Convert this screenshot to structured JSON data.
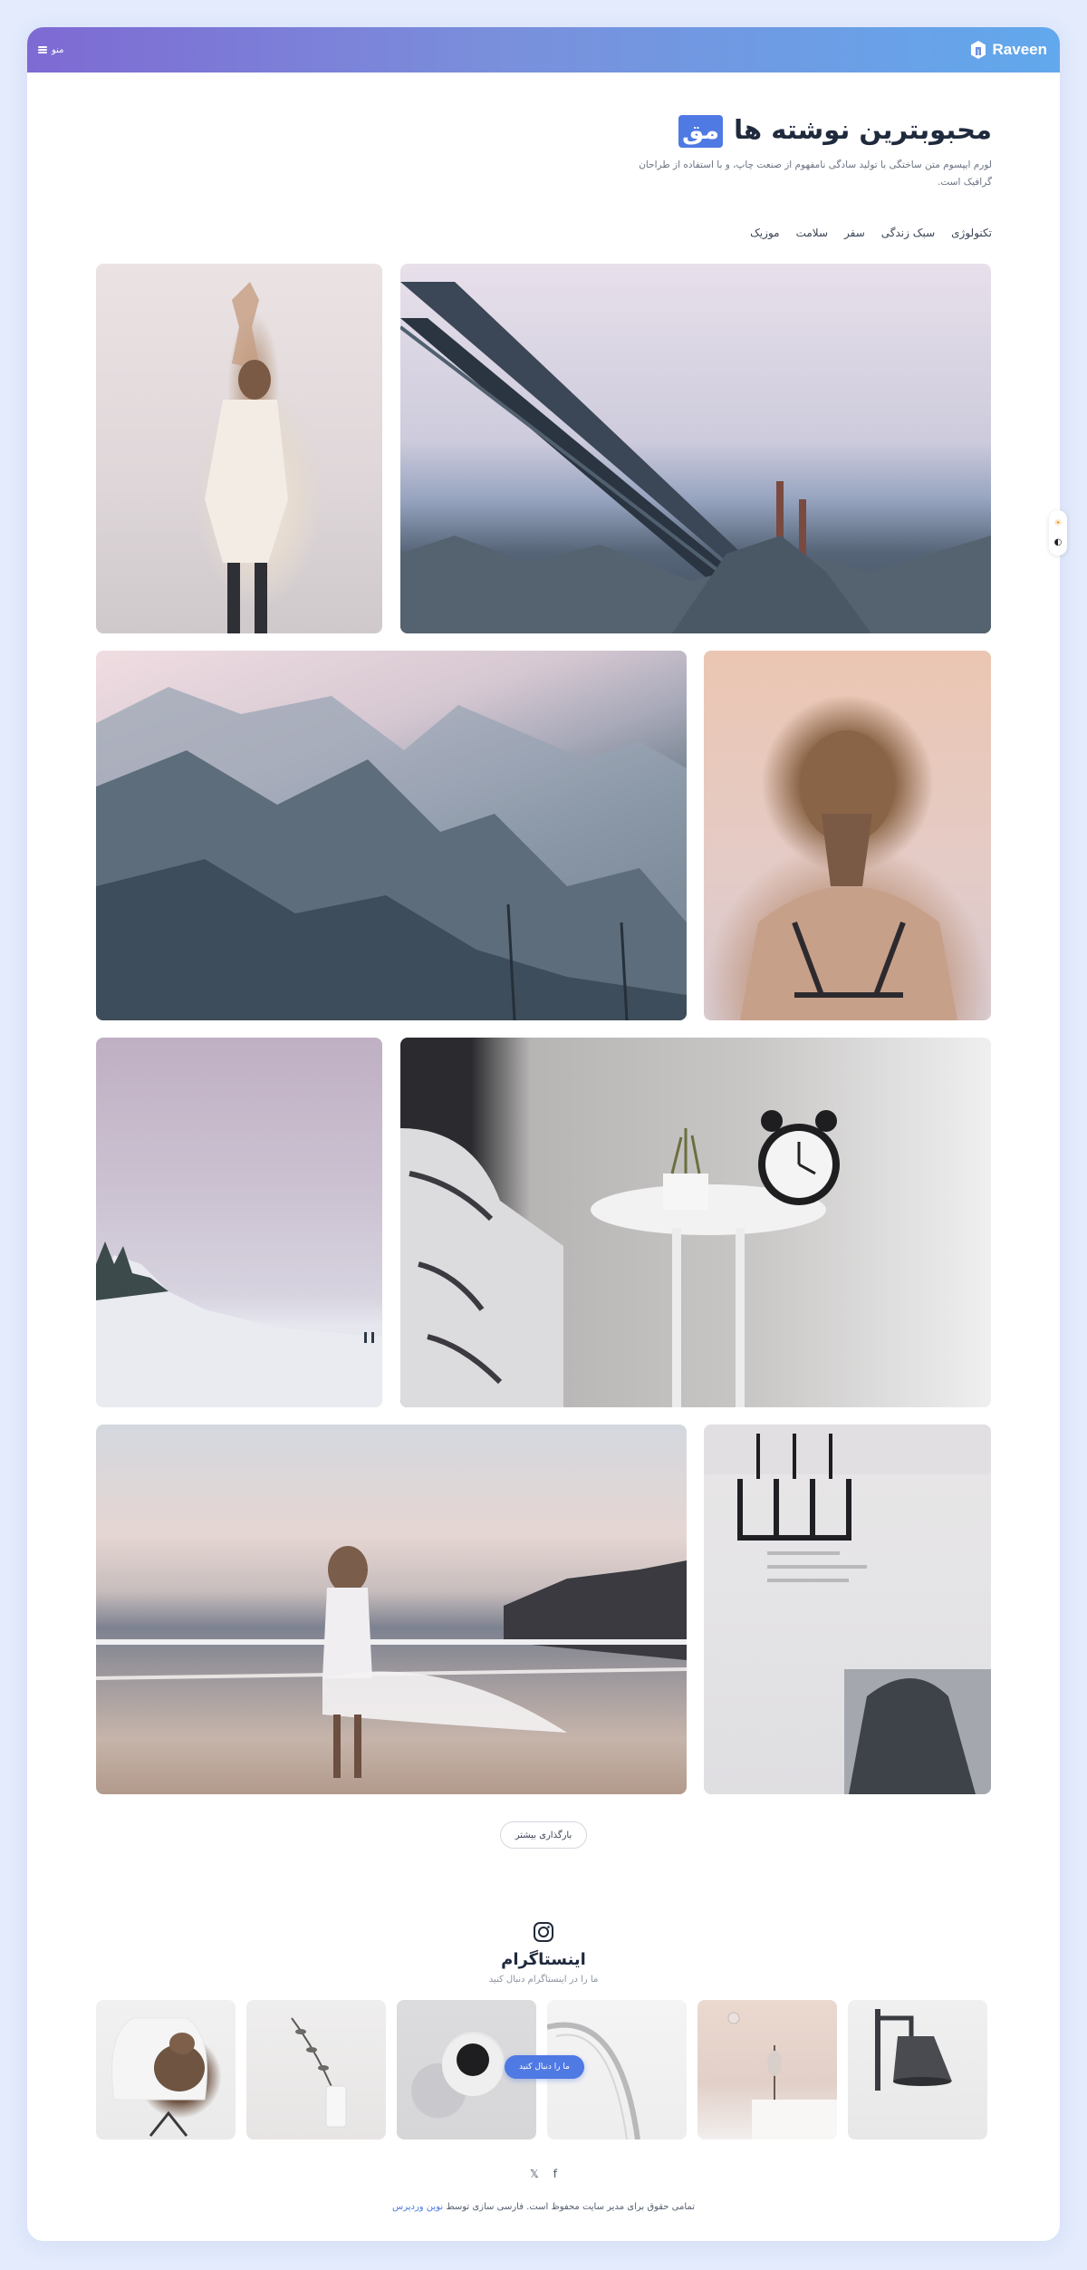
{
  "header": {
    "menu_label": "منو",
    "logo_text": "Raveen"
  },
  "hero": {
    "title": "محبوبترین نوشته ها",
    "badge": "مق",
    "description": "لورم ایپسوم متن ساختگی با تولید سادگی نامفهوم از صنعت چاپ، و با استفاده از طراحان گرافیک است."
  },
  "categories": [
    "تکنولوژی",
    "سبک زندگی",
    "سفر",
    "سلامت",
    "موزیک"
  ],
  "load_more_label": "بارگذاری بیشتر",
  "instagram": {
    "title": "اینستاگرام",
    "subtitle": "ما را در اینستاگرام دنبال کنید",
    "follow_label": "ما را دنبال کنید"
  },
  "social_icons": [
    "x-icon",
    "facebook-icon"
  ],
  "footer": {
    "copyright": "تمامی حقوق برای مدیر سایت محفوظ است. فارسی سازی توسط",
    "credit": "نوین وردپرس"
  },
  "colors": {
    "accent": "#4f79e3",
    "background": "#e3ebfd",
    "header_gradient_start": "#7e6ad3",
    "header_gradient_end": "#62a8ec"
  }
}
